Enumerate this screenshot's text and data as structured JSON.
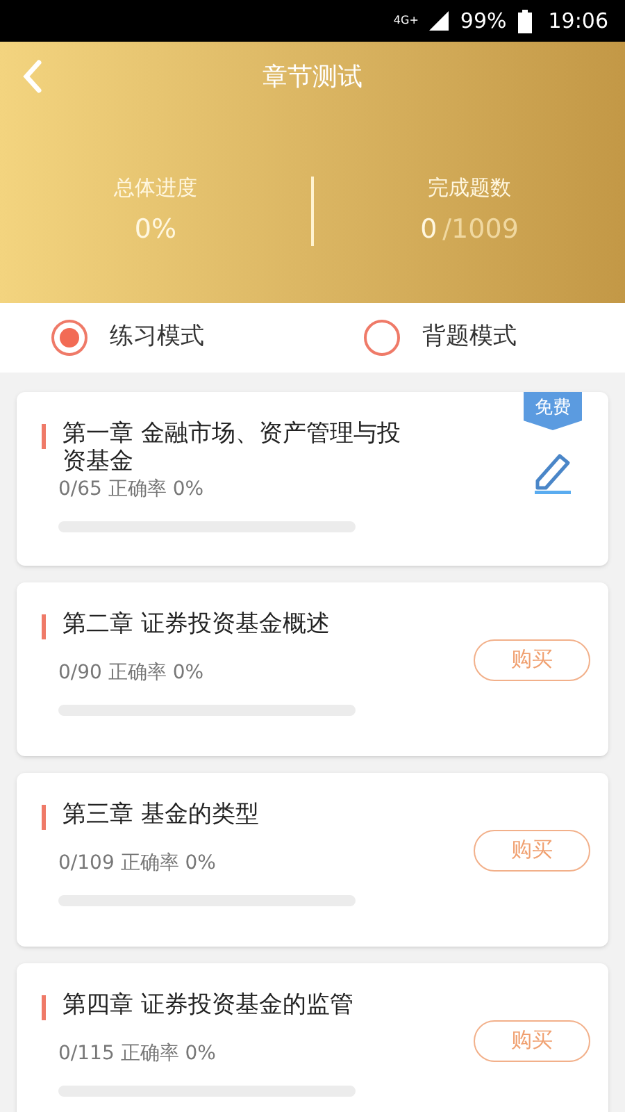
{
  "status_bar": {
    "network": "4G+",
    "battery": "99%",
    "time": "19:06"
  },
  "header": {
    "title": "章节测试"
  },
  "summary": {
    "progress_label": "总体进度",
    "progress_value": "0%",
    "done_label": "完成题数",
    "done_value": "0",
    "done_total": "/1009"
  },
  "modes": [
    {
      "label": "练习模式",
      "selected": true
    },
    {
      "label": "背题模式",
      "selected": false
    }
  ],
  "chapters": [
    {
      "kind": "free",
      "title": "第一章 金融市场、资产管理与投资基金",
      "stats": "0/65 正确率 0%",
      "level": 0,
      "badge": "免费"
    },
    {
      "kind": "buy",
      "title": "第二章 证券投资基金概述",
      "stats": "0/90 正确率 0%",
      "level": 0,
      "button": "购买"
    },
    {
      "kind": "buy",
      "title": "第三章 基金的类型",
      "stats": "0/109 正确率 0%",
      "level": 0,
      "button": "购买"
    },
    {
      "kind": "buy",
      "title": "第四章 证券投资基金的监管",
      "stats": "0/115 正确率 0%",
      "level": 0,
      "button": "购买"
    }
  ]
}
